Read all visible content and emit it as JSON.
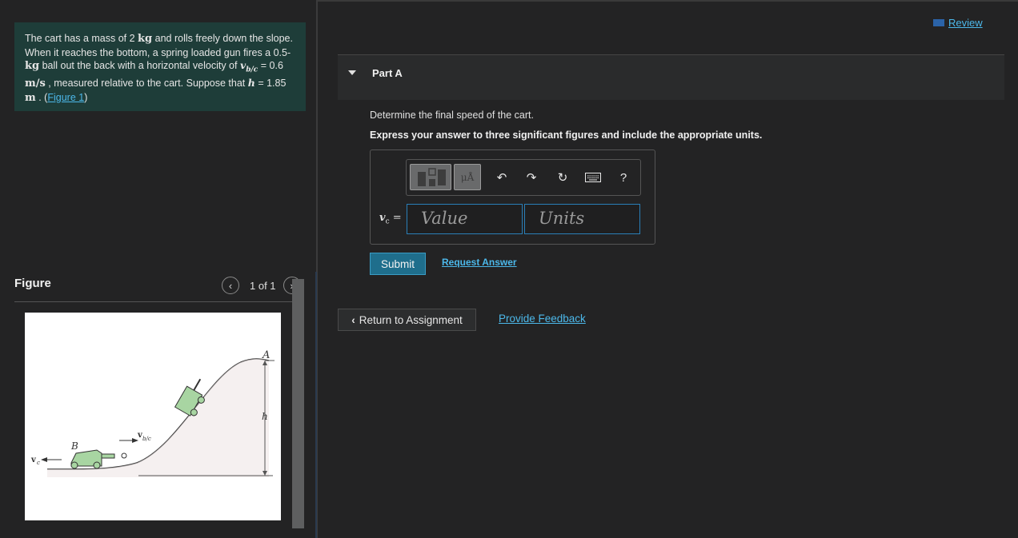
{
  "problem": {
    "t1": "The cart has a mass of 2 ",
    "u1": "kg",
    "t2": " and rolls freely down the slope. When it reaches the bottom, a spring loaded gun fires a 0.5-",
    "u2": "kg",
    "t3": " ball out the back with a horizontal velocity of ",
    "v1": "v",
    "v1sub": "b/c",
    "t4": " = 0.6 ",
    "u3": "m/s",
    "t5": " , measured relative to the cart. Suppose that ",
    "v2": "h",
    "t6": " = 1.85 ",
    "u4": "m",
    "t7": " . (",
    "link": "Figure 1",
    "t8": ")"
  },
  "figure": {
    "title": "Figure",
    "pager": "1 of 1",
    "prev_icon": "chevron-left-icon",
    "next_icon": "chevron-right-icon",
    "labels": {
      "A": "A",
      "B": "B",
      "h": "h",
      "vc": "v",
      "vc_sub": "c",
      "vbc": "v",
      "vbc_sub": "b/c"
    }
  },
  "header": {
    "review": "Review"
  },
  "part": {
    "title": "Part A"
  },
  "question": "Determine the final speed of the cart.",
  "instruction": "Express your answer to three significant figures and include the appropriate units.",
  "answer": {
    "label_var": "v",
    "label_sub": "c",
    "label_eq": " =",
    "value_placeholder": "Value",
    "units_placeholder": "Units",
    "tool_units": "μÅ",
    "tool_help": "?"
  },
  "buttons": {
    "submit": "Submit",
    "request": "Request Answer",
    "return": "Return to Assignment",
    "feedback": "Provide Feedback"
  },
  "colors": {
    "accent": "#4cb8ea",
    "problem_bg": "#1e3d39",
    "submit_bg": "#1f6e8c",
    "cart": "#a8d5a2"
  }
}
